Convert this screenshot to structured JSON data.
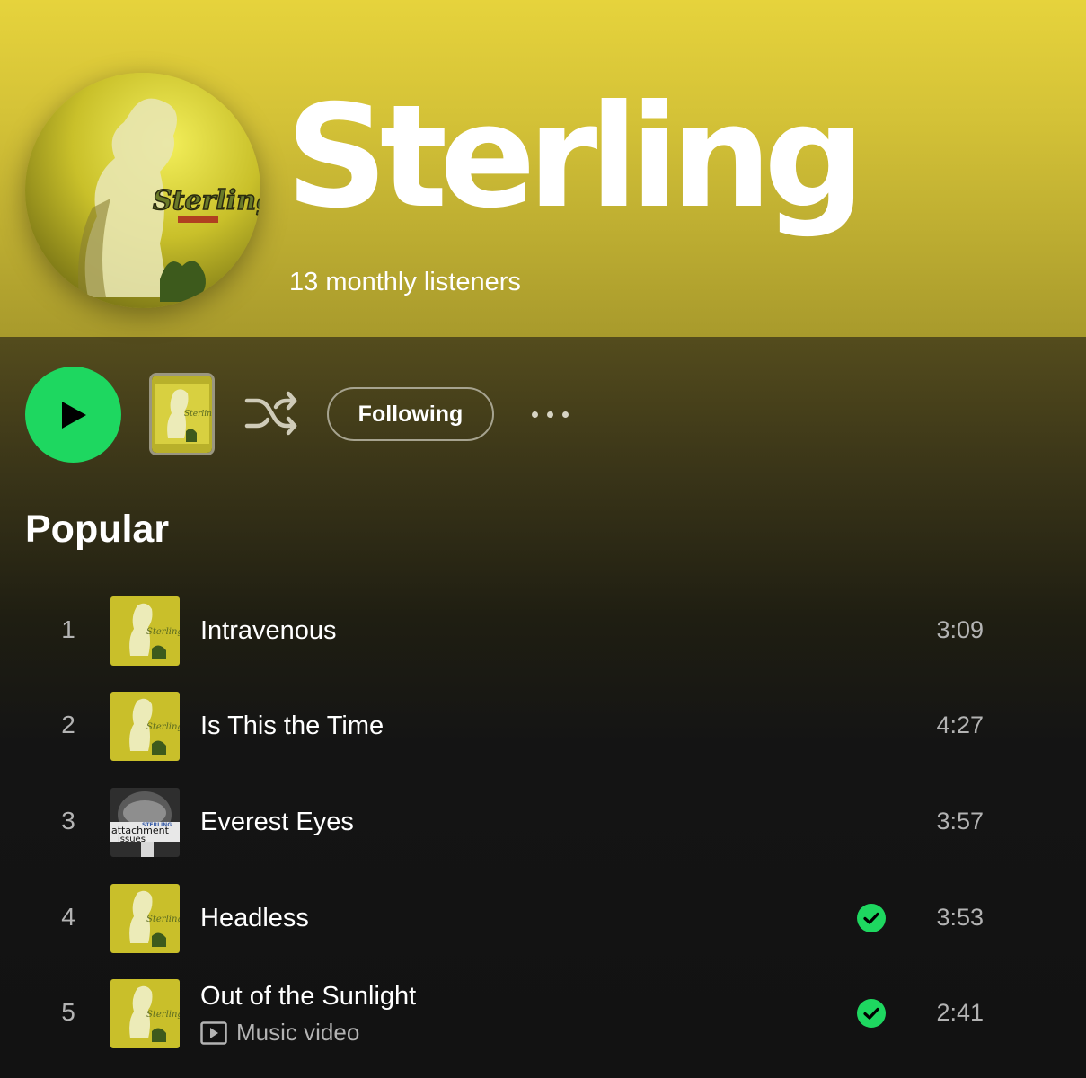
{
  "artist": {
    "name": "Sterling",
    "monthly_listeners": "13 monthly listeners"
  },
  "controls": {
    "follow_label": "Following"
  },
  "popular": {
    "title": "Popular",
    "tracks": [
      {
        "number": "1",
        "title": "Intravenous",
        "duration": "3:09",
        "downloaded": false,
        "cover": "sterling-album"
      },
      {
        "number": "2",
        "title": "Is This the Time",
        "duration": "4:27",
        "downloaded": false,
        "cover": "sterling-album"
      },
      {
        "number": "3",
        "title": "Everest Eyes",
        "duration": "3:57",
        "downloaded": false,
        "cover": "attachment-issues"
      },
      {
        "number": "4",
        "title": "Headless",
        "duration": "3:53",
        "downloaded": true,
        "cover": "sterling-album"
      },
      {
        "number": "5",
        "title": "Out of the Sunlight",
        "subtitle": "Music video",
        "duration": "2:41",
        "downloaded": true,
        "cover": "sterling-album"
      }
    ]
  },
  "cover_art_text": {
    "sterling_album": "Sterling",
    "attachment_issues": [
      "STERLING",
      "attachment",
      "issues"
    ]
  },
  "colors": {
    "accent_green": "#1ed760",
    "hero_yellow": "#e6d33c",
    "background": "#121212"
  }
}
